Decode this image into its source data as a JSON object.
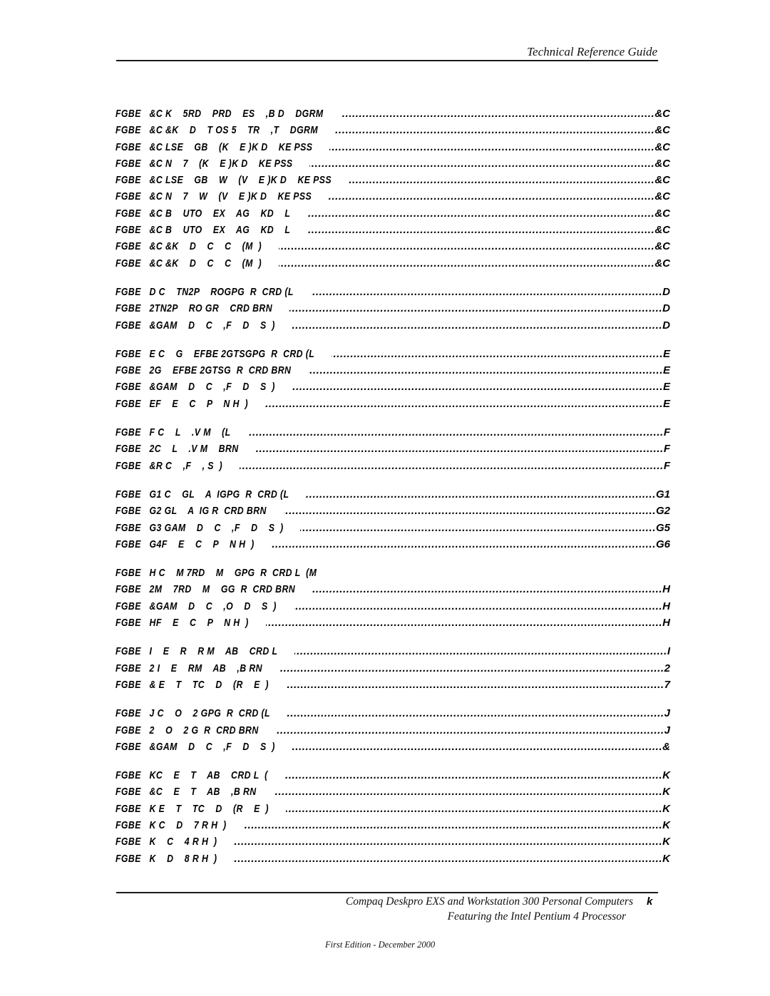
{
  "header": {
    "title": "Technical Reference Guide"
  },
  "toc": {
    "groups": [
      {
        "rows": [
          {
            "fig": "FGBE",
            "title": "&C K    5RD    PRD    ES    ,B D    DGRM",
            "page": "&C"
          },
          {
            "fig": "FGBE",
            "title": "&C &K    D    T OS 5    TR    ,T    DGRM",
            "page": "&C"
          },
          {
            "fig": "FGBE",
            "title": "&C LSE    GB    (K    E )K D    KE PSS",
            "page": "&C"
          },
          {
            "fig": "FGBE",
            "title": "&C N    7    (K    E )K D    KE PSS",
            "page": "&C"
          },
          {
            "fig": "FGBE",
            "title": "&C LSE    GB    W    (V    E )K D    KE PSS",
            "page": "&C"
          },
          {
            "fig": "FGBE",
            "title": "&C N    7    W    (V    E )K D    KE PSS",
            "page": "&C"
          },
          {
            "fig": "FGBE",
            "title": "&C B    UTO    EX    AG    KD    L",
            "page": "&C"
          },
          {
            "fig": "FGBE",
            "title": "&C B    UTO    EX    AG    KD    L",
            "page": "&C"
          },
          {
            "fig": "FGBE",
            "title": "&C &K    D    C    C    (M  )",
            "page": "&C"
          },
          {
            "fig": "FGBE",
            "title": "&C &K    D    C    C    (M  )",
            "page": "&C"
          }
        ]
      },
      {
        "rows": [
          {
            "fig": "FGBE",
            "title": "D C    TN2P    ROGPG  R  CRD (L",
            "page": "D"
          },
          {
            "fig": "FGBE",
            "title": "2TN2P    RO GR    CRD BRN",
            "page": "D"
          },
          {
            "fig": "FGBE",
            "title": "&GAM    D    C    ,F    D    S  )",
            "page": "D"
          }
        ]
      },
      {
        "rows": [
          {
            "fig": "FGBE",
            "title": "E C    G    EFBE 2GTSGPG  R  CRD (L",
            "page": "E"
          },
          {
            "fig": "FGBE",
            "title": "2G    EFBE 2GTSG  R  CRD BRN",
            "page": "E"
          },
          {
            "fig": "FGBE",
            "title": "&GAM    D    C    ,F    D    S  )",
            "page": "E"
          },
          {
            "fig": "FGBE",
            "title": "EF    E    C    P    N H  )",
            "page": "E"
          }
        ]
      },
      {
        "rows": [
          {
            "fig": "FGBE",
            "title": "F C    L    .V M    (L",
            "page": "F"
          },
          {
            "fig": "FGBE",
            "title": "2C    L    .V M    BRN",
            "page": "F"
          },
          {
            "fig": "FGBE",
            "title": "&R C    ,F    , S  )",
            "page": "F"
          }
        ]
      },
      {
        "rows": [
          {
            "fig": "FGBE",
            "title": "G1 C    GL    A  IGPG  R  CRD (L",
            "page": "G1"
          },
          {
            "fig": "FGBE",
            "title": "G2 GL    A  IG R  CRD BRN",
            "page": "G2"
          },
          {
            "fig": "FGBE",
            "title": "G3 GAM    D    C    ,F    D    S  )",
            "page": "G5"
          },
          {
            "fig": "FGBE",
            "title": "G4F    E    C    P    N H  )",
            "page": "G6"
          }
        ]
      },
      {
        "rows": [
          {
            "fig": "FGBE",
            "title": "H C    M 7RD    M    GPG  R  CRD L  (M",
            "page": ""
          },
          {
            "fig": "FGBE",
            "title": "2M    7RD    M    GG  R  CRD BRN",
            "page": "H"
          },
          {
            "fig": "FGBE",
            "title": "&GAM    D    C    ,O    D    S  )",
            "page": "H"
          },
          {
            "fig": "FGBE",
            "title": "HF    E    C    P    N H  )",
            "page": "H"
          }
        ]
      },
      {
        "rows": [
          {
            "fig": "FGBE",
            "title": "I    E    R    R M    AB    CRD L",
            "page": "I"
          },
          {
            "fig": "FGBE",
            "title": "2 I    E    RM    AB    ,B RN",
            "page": "2"
          },
          {
            "fig": "FGBE",
            "title": "& E    T    TC    D    (R    E  )",
            "page": "7"
          }
        ]
      },
      {
        "rows": [
          {
            "fig": "FGBE",
            "title": "J C    O    2 GPG  R  CRD (L",
            "page": "J"
          },
          {
            "fig": "FGBE",
            "title": "2    O    2 G  R  CRD BRN",
            "page": "J"
          },
          {
            "fig": "FGBE",
            "title": "&GAM    D    C    ,F    D    S  )",
            "page": "&"
          }
        ]
      },
      {
        "rows": [
          {
            "fig": "FGBE",
            "title": "KC    E    T    AB    CRD L  (",
            "page": "K"
          },
          {
            "fig": "FGBE",
            "title": "&C    E    T    AB    ,B RN",
            "page": "K"
          },
          {
            "fig": "FGBE",
            "title": "K E    T    TC    D    (R    E  )",
            "page": "K"
          },
          {
            "fig": "FGBE",
            "title": "K C    D    7 R H  )",
            "page": "K"
          },
          {
            "fig": "FGBE",
            "title": "K    C    4 R H  )",
            "page": "K"
          },
          {
            "fig": "FGBE",
            "title": "K    D    8 R H  )",
            "page": "K"
          }
        ]
      }
    ]
  },
  "footer": {
    "line1": "Compaq Deskpro EXS and Workstation 300 Personal Computers",
    "page_number": "k",
    "line2": "Featuring the Intel Pentium 4 Processor",
    "edition": "First Edition - December 2000"
  }
}
